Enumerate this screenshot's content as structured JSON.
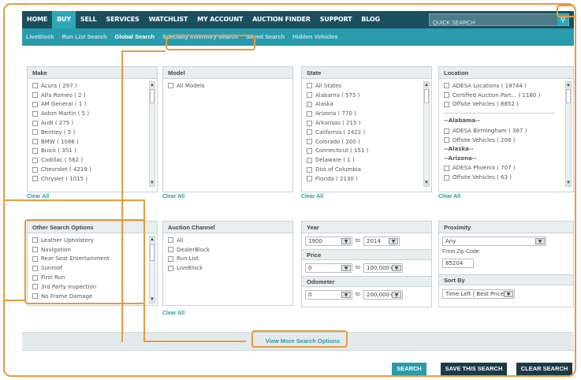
{
  "topnav": {
    "items": [
      "HOME",
      "BUY",
      "SELL",
      "SERVICES",
      "WATCHLIST",
      "MY ACCOUNT",
      "AUCTION FINDER",
      "SUPPORT",
      "BLOG"
    ],
    "active": "BUY",
    "quick_search_placeholder": "QUICK SEARCH"
  },
  "subnav": {
    "items": [
      "LiveBlock",
      "Run List Search",
      "Global Search",
      "Specialty Inventory Search",
      "Saved Search",
      "Hidden Vehicles"
    ],
    "current": "Global Search"
  },
  "make": {
    "title": "Make",
    "items": [
      "Acura ( 297 )",
      "Alfa Romeo ( 2 )",
      "AM General ( 1 )",
      "Aston Martin ( 5 )",
      "Audi ( 275 )",
      "Bentley ( 5 )",
      "BMW ( 1086 )",
      "Buick ( 351 )",
      "Cadillac ( 562 )",
      "Chevrolet ( 4219 )",
      "Chrysler ( 1015 )"
    ],
    "clear": "Clear All"
  },
  "model": {
    "title": "Model",
    "items": [
      "All Models"
    ],
    "clear": "Clear All"
  },
  "state": {
    "title": "State",
    "items": [
      "All States",
      "Alabama ( 575 )",
      "Alaska",
      "Arizona ( 770 )",
      "Arkansas ( 215 )",
      "California ( 2422 )",
      "Colorado ( 200 )",
      "Connecticut ( 151 )",
      "Delaware ( 1 )",
      "Dist of Columbia",
      "Florida ( 2130 )"
    ],
    "clear": "Clear All"
  },
  "location": {
    "title": "Location",
    "items": [
      "ADESA Locations ( 18744 )",
      "Certified Auction Part... ( 1180 )",
      "Offsite Vehicles ( 8852 )"
    ],
    "groups": [
      {
        "label": "--Alabama--",
        "items": [
          "ADESA Birmingham ( 367 )",
          "Offsite Vehicles ( 208 )"
        ]
      },
      {
        "label": "--Alaska--",
        "items": []
      },
      {
        "label": "--Arizona--",
        "items": [
          "ADESA Phoenix ( 707 )",
          "Offsite Vehicles ( 63 )"
        ]
      }
    ],
    "clear": "Clear All"
  },
  "other": {
    "title": "Other Search Options",
    "items": [
      "Leather Upholstery",
      "Navigation",
      "Rear Seat Entertainment",
      "Sunroof",
      "First Run",
      "3rd Party Inspection",
      "No Frame Damage"
    ]
  },
  "channel": {
    "title": "Auction Channel",
    "items": [
      "All",
      "DealerBlock",
      "Run List",
      "LiveBlock"
    ],
    "clear": "Clear All"
  },
  "year": {
    "title": "Year",
    "from": "1900",
    "to_label": "to",
    "to": "2014"
  },
  "price": {
    "title": "Price",
    "from": "0",
    "to_label": "to",
    "to": "100,000+"
  },
  "odometer": {
    "title": "Odometer",
    "from": "0",
    "to_label": "to",
    "to": "200,000+"
  },
  "proximity": {
    "title": "Proximity",
    "value": "Any",
    "zip_label": "From Zip Code:",
    "zip": "85204"
  },
  "sortby": {
    "title": "Sort By",
    "value": "Time Left | Best Price"
  },
  "view_more": "View More Search Options",
  "buttons": {
    "search": "SEARCH",
    "save": "SAVE THIS SEARCH",
    "clear": "CLEAR SEARCH"
  },
  "colors": {
    "accent": "#2a9bad",
    "nav": "#1b4f5e",
    "callout": "#e89a3c"
  }
}
